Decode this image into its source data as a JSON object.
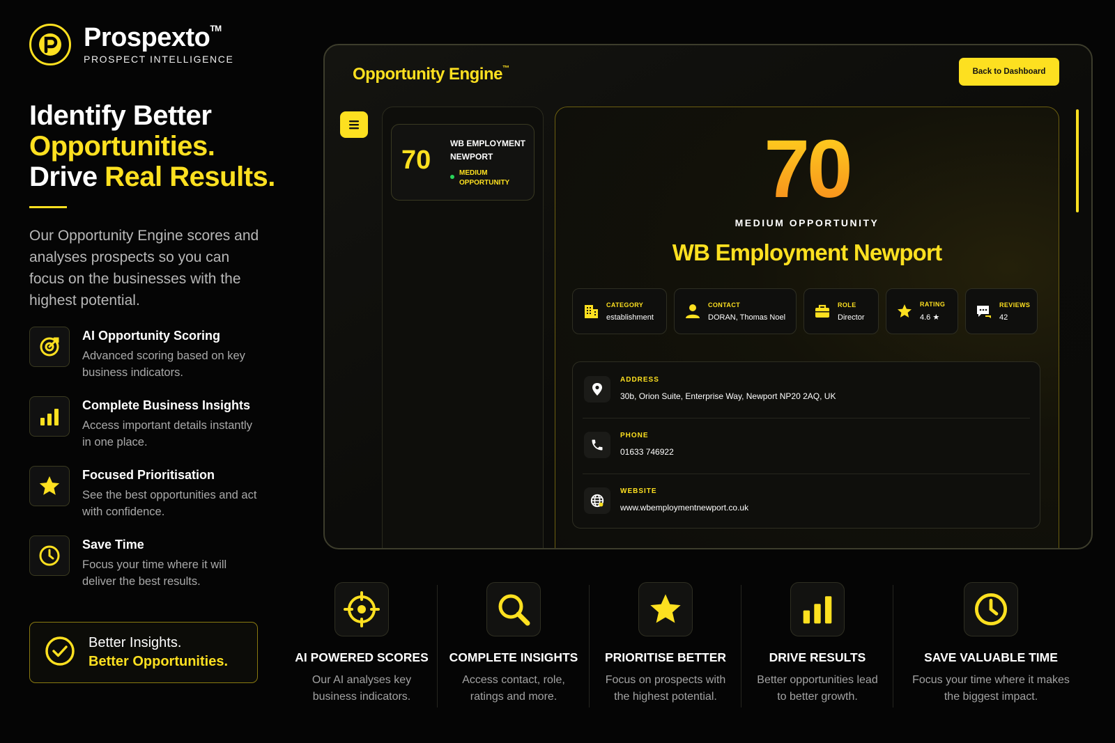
{
  "brand": {
    "name": "Prospexto",
    "tm": "TM",
    "tagline": "PROSPECT INTELLIGENCE"
  },
  "hero": {
    "line1": "Identify Better",
    "line2": "Opportunities.",
    "line3_white": "Drive ",
    "line3_yellow": "Real Results."
  },
  "intro": "Our Opportunity Engine scores and analyses prospects so you can focus on the businesses with the highest potential.",
  "features": [
    {
      "title": "AI Opportunity Scoring",
      "desc": "Advanced scoring based on key business indicators.",
      "icon": "target-icon"
    },
    {
      "title": "Complete Business Insights",
      "desc": "Access important details instantly in one place.",
      "icon": "bar-chart-icon"
    },
    {
      "title": "Focused Prioritisation",
      "desc": "See the best opportunities and act with confidence.",
      "icon": "star-icon"
    },
    {
      "title": "Save Time",
      "desc": "Focus your time where it will deliver the best results.",
      "icon": "clock-icon"
    }
  ],
  "callout": {
    "line1": "Better Insights.",
    "line2": "Better Opportunities."
  },
  "app": {
    "title": "Opportunity Engine",
    "title_tm": "™",
    "back_button": "Back to Dashboard",
    "list_item": {
      "score": "70",
      "name": "WB EMPLOYMENT NEWPORT",
      "status": "MEDIUM OPPORTUNITY"
    },
    "detail": {
      "score": "70",
      "level": "MEDIUM OPPORTUNITY",
      "company": "WB Employment Newport",
      "stats": [
        {
          "label": "CATEGORY",
          "value": "establishment",
          "icon": "building-icon"
        },
        {
          "label": "CONTACT",
          "value": "DORAN, Thomas Noel",
          "icon": "person-icon"
        },
        {
          "label": "ROLE",
          "value": "Director",
          "icon": "briefcase-icon"
        },
        {
          "label": "RATING",
          "value": "4.6 ★",
          "icon": "star-icon"
        },
        {
          "label": "REVIEWS",
          "value": "42",
          "icon": "chat-icon"
        }
      ],
      "address_label": "ADDRESS",
      "address": "30b, Orion Suite, Enterprise Way, Newport NP20 2AQ, UK",
      "phone_label": "PHONE",
      "phone": "01633 746922",
      "website_label": "WEBSITE",
      "website": "www.wbemploymentnewport.co.uk"
    }
  },
  "benefits": [
    {
      "title": "AI POWERED SCORES",
      "desc": "Our AI analyses key business indicators.",
      "icon": "crosshair-icon"
    },
    {
      "title": "COMPLETE INSIGHTS",
      "desc": "Access contact, role, ratings and more.",
      "icon": "search-icon"
    },
    {
      "title": "PRIORITISE BETTER",
      "desc": "Focus on prospects with the highest potential.",
      "icon": "star-icon"
    },
    {
      "title": "DRIVE RESULTS",
      "desc": "Better opportunities lead to better growth.",
      "icon": "bar-chart-icon"
    },
    {
      "title": "SAVE VALUABLE TIME",
      "desc": "Focus your time where it makes the biggest impact.",
      "icon": "clock-icon"
    }
  ],
  "colors": {
    "accent": "#fde020",
    "score_gradient_top": "#ffd21f",
    "score_gradient_bottom": "#f68a1c",
    "status_dot": "#29d35a",
    "background": "#050505"
  }
}
